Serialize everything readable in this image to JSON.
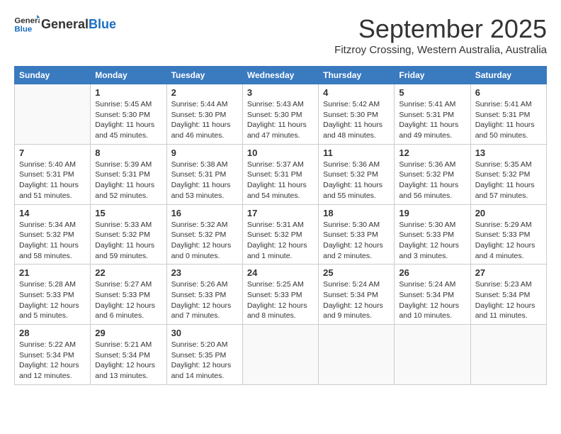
{
  "app": {
    "name": "GeneralBlue",
    "logo_general": "General",
    "logo_blue": "Blue"
  },
  "header": {
    "month_title": "September 2025",
    "subtitle": "Fitzroy Crossing, Western Australia, Australia"
  },
  "weekdays": [
    "Sunday",
    "Monday",
    "Tuesday",
    "Wednesday",
    "Thursday",
    "Friday",
    "Saturday"
  ],
  "weeks": [
    [
      {
        "day": "",
        "info": ""
      },
      {
        "day": "1",
        "info": "Sunrise: 5:45 AM\nSunset: 5:30 PM\nDaylight: 11 hours\nand 45 minutes."
      },
      {
        "day": "2",
        "info": "Sunrise: 5:44 AM\nSunset: 5:30 PM\nDaylight: 11 hours\nand 46 minutes."
      },
      {
        "day": "3",
        "info": "Sunrise: 5:43 AM\nSunset: 5:30 PM\nDaylight: 11 hours\nand 47 minutes."
      },
      {
        "day": "4",
        "info": "Sunrise: 5:42 AM\nSunset: 5:30 PM\nDaylight: 11 hours\nand 48 minutes."
      },
      {
        "day": "5",
        "info": "Sunrise: 5:41 AM\nSunset: 5:31 PM\nDaylight: 11 hours\nand 49 minutes."
      },
      {
        "day": "6",
        "info": "Sunrise: 5:41 AM\nSunset: 5:31 PM\nDaylight: 11 hours\nand 50 minutes."
      }
    ],
    [
      {
        "day": "7",
        "info": "Sunrise: 5:40 AM\nSunset: 5:31 PM\nDaylight: 11 hours\nand 51 minutes."
      },
      {
        "day": "8",
        "info": "Sunrise: 5:39 AM\nSunset: 5:31 PM\nDaylight: 11 hours\nand 52 minutes."
      },
      {
        "day": "9",
        "info": "Sunrise: 5:38 AM\nSunset: 5:31 PM\nDaylight: 11 hours\nand 53 minutes."
      },
      {
        "day": "10",
        "info": "Sunrise: 5:37 AM\nSunset: 5:31 PM\nDaylight: 11 hours\nand 54 minutes."
      },
      {
        "day": "11",
        "info": "Sunrise: 5:36 AM\nSunset: 5:32 PM\nDaylight: 11 hours\nand 55 minutes."
      },
      {
        "day": "12",
        "info": "Sunrise: 5:36 AM\nSunset: 5:32 PM\nDaylight: 11 hours\nand 56 minutes."
      },
      {
        "day": "13",
        "info": "Sunrise: 5:35 AM\nSunset: 5:32 PM\nDaylight: 11 hours\nand 57 minutes."
      }
    ],
    [
      {
        "day": "14",
        "info": "Sunrise: 5:34 AM\nSunset: 5:32 PM\nDaylight: 11 hours\nand 58 minutes."
      },
      {
        "day": "15",
        "info": "Sunrise: 5:33 AM\nSunset: 5:32 PM\nDaylight: 11 hours\nand 59 minutes."
      },
      {
        "day": "16",
        "info": "Sunrise: 5:32 AM\nSunset: 5:32 PM\nDaylight: 12 hours\nand 0 minutes."
      },
      {
        "day": "17",
        "info": "Sunrise: 5:31 AM\nSunset: 5:32 PM\nDaylight: 12 hours\nand 1 minute."
      },
      {
        "day": "18",
        "info": "Sunrise: 5:30 AM\nSunset: 5:33 PM\nDaylight: 12 hours\nand 2 minutes."
      },
      {
        "day": "19",
        "info": "Sunrise: 5:30 AM\nSunset: 5:33 PM\nDaylight: 12 hours\nand 3 minutes."
      },
      {
        "day": "20",
        "info": "Sunrise: 5:29 AM\nSunset: 5:33 PM\nDaylight: 12 hours\nand 4 minutes."
      }
    ],
    [
      {
        "day": "21",
        "info": "Sunrise: 5:28 AM\nSunset: 5:33 PM\nDaylight: 12 hours\nand 5 minutes."
      },
      {
        "day": "22",
        "info": "Sunrise: 5:27 AM\nSunset: 5:33 PM\nDaylight: 12 hours\nand 6 minutes."
      },
      {
        "day": "23",
        "info": "Sunrise: 5:26 AM\nSunset: 5:33 PM\nDaylight: 12 hours\nand 7 minutes."
      },
      {
        "day": "24",
        "info": "Sunrise: 5:25 AM\nSunset: 5:33 PM\nDaylight: 12 hours\nand 8 minutes."
      },
      {
        "day": "25",
        "info": "Sunrise: 5:24 AM\nSunset: 5:34 PM\nDaylight: 12 hours\nand 9 minutes."
      },
      {
        "day": "26",
        "info": "Sunrise: 5:24 AM\nSunset: 5:34 PM\nDaylight: 12 hours\nand 10 minutes."
      },
      {
        "day": "27",
        "info": "Sunrise: 5:23 AM\nSunset: 5:34 PM\nDaylight: 12 hours\nand 11 minutes."
      }
    ],
    [
      {
        "day": "28",
        "info": "Sunrise: 5:22 AM\nSunset: 5:34 PM\nDaylight: 12 hours\nand 12 minutes."
      },
      {
        "day": "29",
        "info": "Sunrise: 5:21 AM\nSunset: 5:34 PM\nDaylight: 12 hours\nand 13 minutes."
      },
      {
        "day": "30",
        "info": "Sunrise: 5:20 AM\nSunset: 5:35 PM\nDaylight: 12 hours\nand 14 minutes."
      },
      {
        "day": "",
        "info": ""
      },
      {
        "day": "",
        "info": ""
      },
      {
        "day": "",
        "info": ""
      },
      {
        "day": "",
        "info": ""
      }
    ]
  ]
}
